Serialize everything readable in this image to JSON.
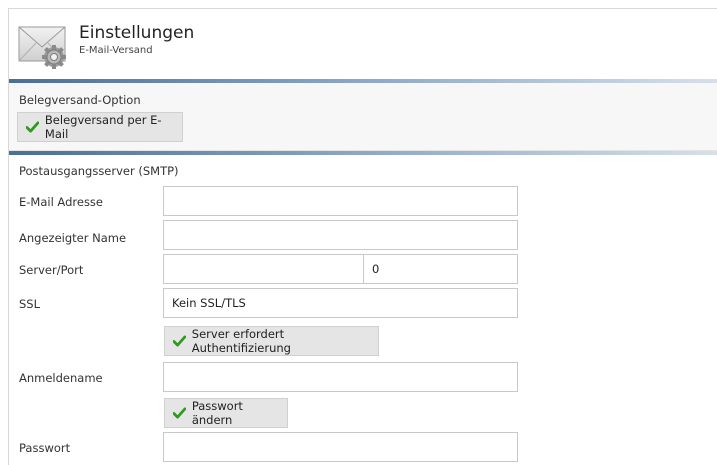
{
  "header": {
    "title": "Einstellungen",
    "subtitle": "E-Mail-Versand",
    "icon": "envelope-gear-icon"
  },
  "belegversand": {
    "section_label": "Belegversand-Option",
    "toggle_label": "Belegversand per E-Mail",
    "toggle_checked": true
  },
  "smtp": {
    "section_label": "Postausgangsserver (SMTP)",
    "email_label": "E-Mail Adresse",
    "email_value": "",
    "display_name_label": "Angezeigter Name",
    "display_name_value": "",
    "server_port_label": "Server/Port",
    "server_value": "",
    "port_value": "0",
    "ssl_label": "SSL",
    "ssl_value": "Kein SSL/TLS",
    "auth_toggle_label": "Server erfordert Authentifizierung",
    "auth_checked": true,
    "login_label": "Anmeldename",
    "login_value": "",
    "change_password_label": "Passwort ändern",
    "change_password_checked": true,
    "password_label": "Passwort",
    "password_value": ""
  },
  "colors": {
    "check_green": "#2e9a1e",
    "divider_blue": "#4a6f95"
  }
}
